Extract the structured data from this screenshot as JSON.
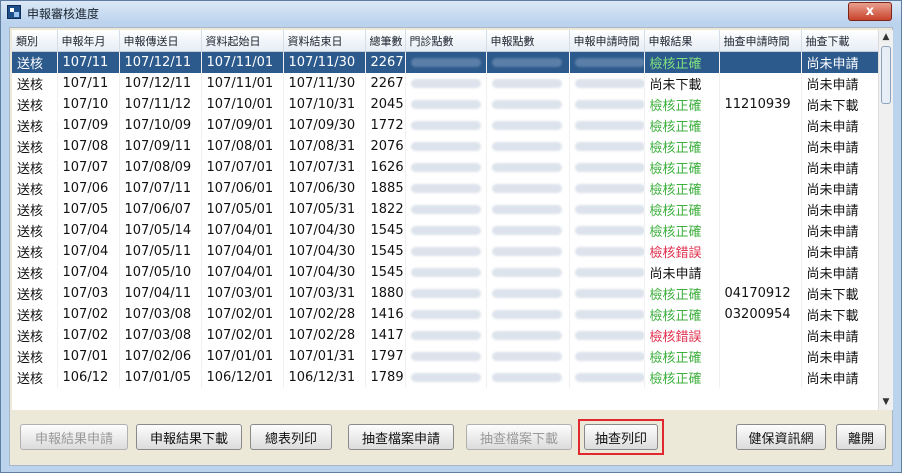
{
  "window": {
    "title": "申報審核進度",
    "close_label": "x"
  },
  "table": {
    "columns": [
      "類別",
      "申報年月",
      "申報傳送日",
      "資料起始日",
      "資料結束日",
      "總筆數",
      "門診點數",
      "申報點數",
      "申報申請時間",
      "申報結果",
      "抽查申請時間",
      "抽查下載"
    ],
    "rows": [
      [
        "送核",
        "107/11",
        "107/12/11",
        "107/11/01",
        "107/11/30",
        "2267",
        "",
        "",
        "",
        "檢核正確",
        "",
        "尚未申請"
      ],
      [
        "送核",
        "107/11",
        "107/12/11",
        "107/11/01",
        "107/11/30",
        "2267",
        "",
        "",
        "",
        "尚未下載",
        "",
        "尚未申請"
      ],
      [
        "送核",
        "107/10",
        "107/11/12",
        "107/10/01",
        "107/10/31",
        "2045",
        "",
        "",
        "",
        "檢核正確",
        "11210939",
        "尚未下載"
      ],
      [
        "送核",
        "107/09",
        "107/10/09",
        "107/09/01",
        "107/09/30",
        "1772",
        "",
        "",
        "",
        "檢核正確",
        "",
        "尚未申請"
      ],
      [
        "送核",
        "107/08",
        "107/09/11",
        "107/08/01",
        "107/08/31",
        "2076",
        "",
        "",
        "",
        "檢核正確",
        "",
        "尚未申請"
      ],
      [
        "送核",
        "107/07",
        "107/08/09",
        "107/07/01",
        "107/07/31",
        "1626",
        "",
        "",
        "",
        "檢核正確",
        "",
        "尚未申請"
      ],
      [
        "送核",
        "107/06",
        "107/07/11",
        "107/06/01",
        "107/06/30",
        "1885",
        "",
        "",
        "",
        "檢核正確",
        "",
        "尚未申請"
      ],
      [
        "送核",
        "107/05",
        "107/06/07",
        "107/05/01",
        "107/05/31",
        "1822",
        "",
        "",
        "",
        "檢核正確",
        "",
        "尚未申請"
      ],
      [
        "送核",
        "107/04",
        "107/05/14",
        "107/04/01",
        "107/04/30",
        "1545",
        "",
        "",
        "",
        "檢核正確",
        "",
        "尚未申請"
      ],
      [
        "送核",
        "107/04",
        "107/05/11",
        "107/04/01",
        "107/04/30",
        "1545",
        "",
        "",
        "",
        "檢核錯誤",
        "",
        "尚未申請"
      ],
      [
        "送核",
        "107/04",
        "107/05/10",
        "107/04/01",
        "107/04/30",
        "1545",
        "",
        "",
        "",
        "尚未申請",
        "",
        "尚未申請"
      ],
      [
        "送核",
        "107/03",
        "107/04/11",
        "107/03/01",
        "107/03/31",
        "1880",
        "",
        "",
        "",
        "檢核正確",
        "04170912",
        "尚未下載"
      ],
      [
        "送核",
        "107/02",
        "107/03/08",
        "107/02/01",
        "107/02/28",
        "1416",
        "",
        "",
        "",
        "檢核正確",
        "03200954",
        "尚未下載"
      ],
      [
        "送核",
        "107/02",
        "107/03/08",
        "107/02/01",
        "107/02/28",
        "1417",
        "",
        "",
        "",
        "檢核錯誤",
        "",
        "尚未申請"
      ],
      [
        "送核",
        "107/01",
        "107/02/06",
        "107/01/01",
        "107/01/31",
        "1797",
        "",
        "",
        "",
        "檢核正確",
        "",
        "尚未申請"
      ],
      [
        "送核",
        "106/12",
        "107/01/05",
        "106/12/01",
        "106/12/31",
        "1789",
        "",
        "",
        "",
        "檢核正確",
        "",
        "尚未申請"
      ]
    ],
    "blurred_columns": [
      6,
      7,
      8
    ],
    "selected_row": 0
  },
  "result_colors": {
    "檢核正確": "#3fb03f",
    "檢核錯誤": "#e0304e"
  },
  "buttons": [
    {
      "label": "申報結果申請",
      "enabled": false,
      "name": "apply-report-result-button"
    },
    {
      "label": "申報結果下載",
      "enabled": true,
      "name": "download-report-result-button"
    },
    {
      "label": "總表列印",
      "enabled": true,
      "name": "print-summary-button"
    },
    {
      "label": "抽查檔案申請",
      "enabled": true,
      "name": "apply-audit-file-button"
    },
    {
      "label": "抽查檔案下載",
      "enabled": false,
      "name": "download-audit-file-button"
    },
    {
      "label": "抽查列印",
      "enabled": true,
      "name": "print-audit-button",
      "highlighted": true
    },
    {
      "label": "健保資訊網",
      "enabled": true,
      "name": "nhi-network-button"
    },
    {
      "label": "離開",
      "enabled": true,
      "name": "exit-button"
    }
  ]
}
